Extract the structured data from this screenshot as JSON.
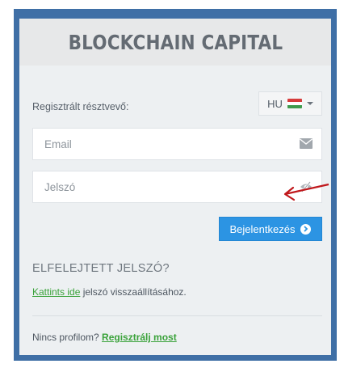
{
  "brand": {
    "title": "BLOCKCHAIN CAPITAL"
  },
  "login": {
    "registered_label": "Regisztrált résztvevő:",
    "language": {
      "code": "HU",
      "flag_icon": "hungary-flag-icon",
      "flag_colors": [
        "#d63b3b",
        "#ffffff",
        "#3f9a4c"
      ]
    },
    "email_placeholder": "Email",
    "email_icon": "envelope-icon",
    "password_placeholder": "Jelszó",
    "password_icon": "eye-slash-icon",
    "submit_label": "Bejelentkezés",
    "submit_icon": "circle-chevron-right-icon"
  },
  "annotation": {
    "arrow_icon": "red-arrow-icon",
    "color": "#c0171b"
  },
  "forgot": {
    "title": "ELFELEJTETT JELSZÓ?",
    "link_text": "Kattints ide",
    "rest_text": " jelszó visszaállításához."
  },
  "signup": {
    "prompt": "Nincs profilom? ",
    "link_text": "Regisztrálj most"
  },
  "colors": {
    "frame": "#3f6fa6",
    "button": "#2c94e3",
    "link": "#3aa23a"
  }
}
